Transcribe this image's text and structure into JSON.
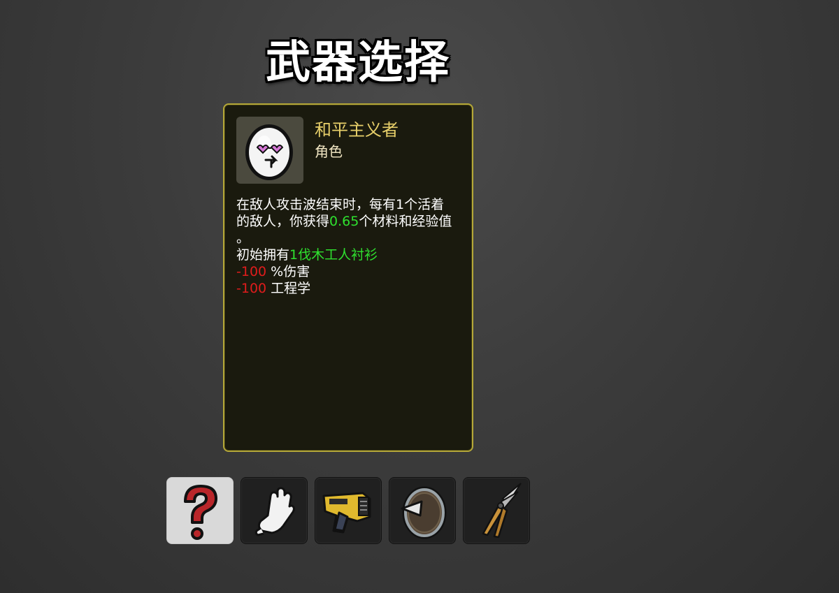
{
  "header": {
    "title": "武器选择"
  },
  "character": {
    "name": "和平主义者",
    "type": "角色",
    "portrait_icon": "egg-face-heart-glasses-icon",
    "description": {
      "line1": "在敌人攻击波结束时，每有1个活着",
      "line2_a": "的敌人，你获得",
      "line2_value": "0.65",
      "line2_b": "个材料和经验值",
      "line3": "。",
      "line4_a": "初始拥有",
      "line4_item": "1伐木工人衬衫",
      "stat1_value": "-100",
      "stat1_label": " %伤害",
      "stat2_value": "-100",
      "stat2_label": " 工程学"
    }
  },
  "weapons": [
    {
      "icon": "random-question-mark-icon",
      "selected": true
    },
    {
      "icon": "fist-hand-icon",
      "selected": false
    },
    {
      "icon": "taser-gun-icon",
      "selected": false
    },
    {
      "icon": "spiked-shield-icon",
      "selected": false
    },
    {
      "icon": "pruning-shears-icon",
      "selected": false
    }
  ],
  "colors": {
    "panel_border": "#b5a838",
    "name_color": "#e8d06a",
    "positive": "#2fe02f",
    "negative": "#e01c1c"
  }
}
